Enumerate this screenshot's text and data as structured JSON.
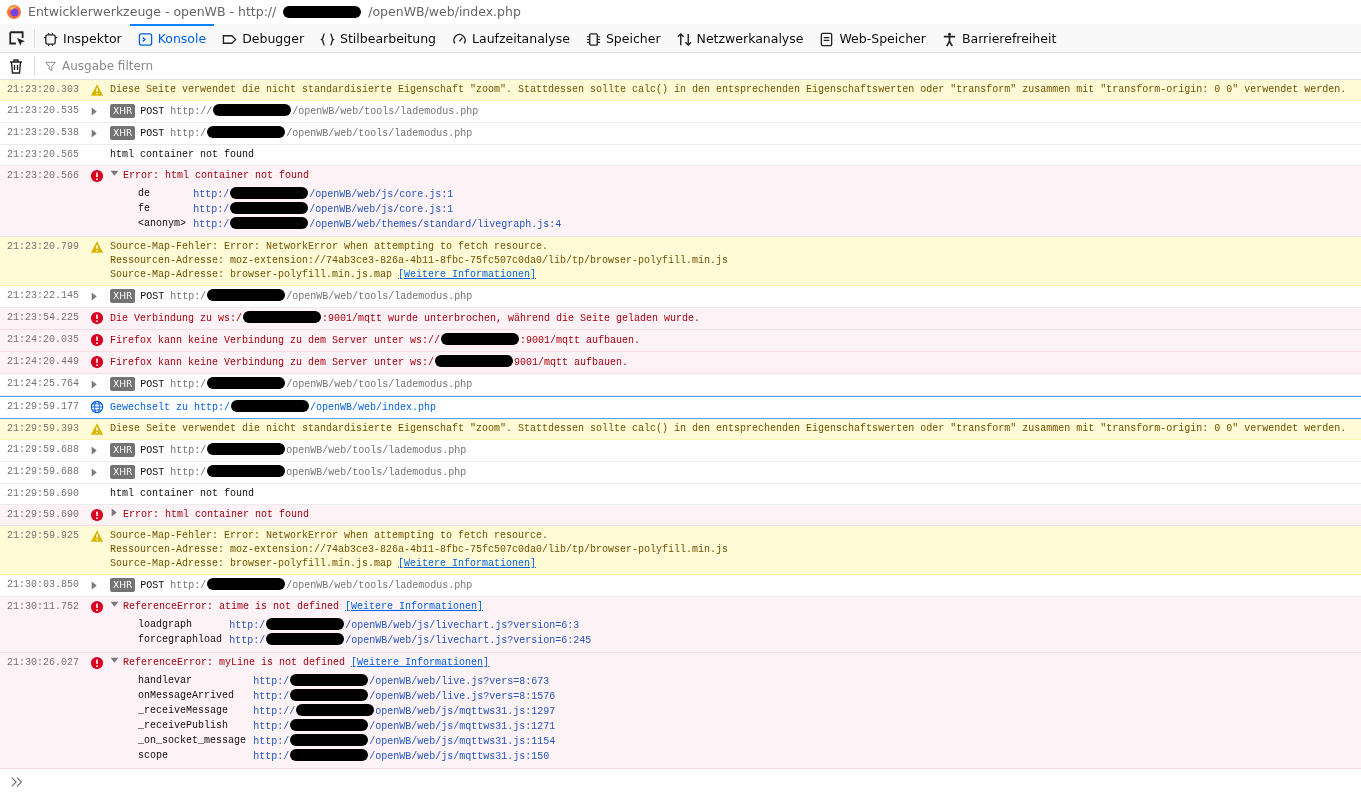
{
  "window": {
    "title": [
      {
        "kind": "text",
        "text": "Entwicklerwerkzeuge - openWB - http://"
      },
      {
        "kind": "redaction"
      },
      {
        "kind": "text",
        "text": "/openWB/web/index.php"
      }
    ]
  },
  "tabs": [
    {
      "label": "Inspektor",
      "selected": false
    },
    {
      "label": "Konsole",
      "selected": true
    },
    {
      "label": "Debugger",
      "selected": false
    },
    {
      "label": "Stilbearbeitung",
      "selected": false
    },
    {
      "label": "Laufzeitanalyse",
      "selected": false
    },
    {
      "label": "Speicher",
      "selected": false
    },
    {
      "label": "Netzwerkanalyse",
      "selected": false
    },
    {
      "label": "Web-Speicher",
      "selected": false
    },
    {
      "label": "Barrierefreiheit",
      "selected": false
    }
  ],
  "filter": {
    "placeholder": "Ausgabe filtern"
  },
  "messages": [
    {
      "time": "21:23:20.303",
      "kind": "warning",
      "lines": [
        [
          {
            "kind": "text",
            "text": "Diese Seite verwendet die nicht standardisierte Eigenschaft \"zoom\". Stattdessen sollte calc() in den entsprechenden Eigenschaftswerten oder \"transform\" zusammen mit \"transform-origin: 0 0\" verwendet werden."
          }
        ]
      ]
    },
    {
      "time": "21:23:20.535",
      "kind": "network",
      "expanded": false,
      "badge": "XHR",
      "method": "POST",
      "lines": [
        [
          {
            "kind": "url",
            "text": "http://"
          },
          {
            "kind": "redaction"
          },
          {
            "kind": "url",
            "text": "/openWB/web/tools/lademodus.php"
          }
        ]
      ]
    },
    {
      "time": "21:23:20.538",
      "kind": "network",
      "expanded": false,
      "badge": "XHR",
      "method": "POST",
      "lines": [
        [
          {
            "kind": "url",
            "text": "http:/"
          },
          {
            "kind": "redaction"
          },
          {
            "kind": "url",
            "text": "/openWB/web/tools/lademodus.php"
          }
        ]
      ]
    },
    {
      "time": "21:23:20.565",
      "kind": "log",
      "lines": [
        [
          {
            "kind": "text",
            "text": "html container not found"
          }
        ]
      ]
    },
    {
      "time": "21:23:20.566",
      "kind": "error",
      "expanded": true,
      "lines": [
        [
          {
            "kind": "text",
            "text": "Error: html container not found"
          }
        ]
      ],
      "stack": [
        {
          "fn": "de",
          "url": [
            {
              "kind": "url",
              "text": "http:/"
            },
            {
              "kind": "redaction"
            },
            {
              "kind": "url",
              "text": "/openWB/web/js/core.js:1"
            }
          ]
        },
        {
          "fn": "fe",
          "url": [
            {
              "kind": "url",
              "text": "http:/"
            },
            {
              "kind": "redaction"
            },
            {
              "kind": "url",
              "text": "/openWB/web/js/core.js:1"
            }
          ]
        },
        {
          "fn": "<anonym>",
          "url": [
            {
              "kind": "url",
              "text": "http:/"
            },
            {
              "kind": "redaction"
            },
            {
              "kind": "url",
              "text": "/openWB/web/themes/standard/livegraph.js:4"
            }
          ]
        }
      ]
    },
    {
      "time": "21:23:20.799",
      "kind": "warning",
      "lines": [
        [
          {
            "kind": "text",
            "text": "Source-Map-Fehler: Error: NetworkError when attempting to fetch resource."
          }
        ],
        [
          {
            "kind": "text",
            "text": "Ressourcen-Adresse: moz-extension://74ab3ce3-826a-4b11-8fbc-75fc507c0da0/lib/tp/browser-polyfill.min.js"
          }
        ],
        [
          {
            "kind": "text",
            "text": "Source-Map-Adresse: browser-polyfill.min.js.map"
          },
          {
            "kind": "link",
            "text": "[Weitere Informationen]"
          }
        ]
      ]
    },
    {
      "time": "21:23:22.145",
      "kind": "network",
      "expanded": false,
      "badge": "XHR",
      "method": "POST",
      "lines": [
        [
          {
            "kind": "url",
            "text": "http:/"
          },
          {
            "kind": "redaction"
          },
          {
            "kind": "url",
            "text": "/openWB/web/tools/lademodus.php"
          }
        ]
      ]
    },
    {
      "time": "21:23:54.225",
      "kind": "error",
      "lines": [
        [
          {
            "kind": "text",
            "text": "Die Verbindung zu ws:/"
          },
          {
            "kind": "redaction"
          },
          {
            "kind": "text",
            "text": ":9001/mqtt wurde unterbrochen, während die Seite geladen wurde."
          }
        ]
      ]
    },
    {
      "time": "21:24:20.035",
      "kind": "error",
      "lines": [
        [
          {
            "kind": "text",
            "text": "Firefox kann keine Verbindung zu dem Server unter ws://"
          },
          {
            "kind": "redaction"
          },
          {
            "kind": "text",
            "text": ":9001/mqtt aufbauen."
          }
        ]
      ]
    },
    {
      "time": "21:24:20.449",
      "kind": "error",
      "lines": [
        [
          {
            "kind": "text",
            "text": "Firefox kann keine Verbindung zu dem Server unter ws:/"
          },
          {
            "kind": "redaction"
          },
          {
            "kind": "text",
            "text": "9001/mqtt aufbauen."
          }
        ]
      ]
    },
    {
      "time": "21:24:25.764",
      "kind": "network",
      "expanded": false,
      "badge": "XHR",
      "method": "POST",
      "lines": [
        [
          {
            "kind": "url",
            "text": "http:/"
          },
          {
            "kind": "redaction"
          },
          {
            "kind": "url",
            "text": "/openWB/web/tools/lademodus.php"
          }
        ]
      ]
    },
    {
      "time": "21:29:59.177",
      "kind": "navigation",
      "lines": [
        [
          {
            "kind": "text",
            "text": "Gewechselt zu http:/"
          },
          {
            "kind": "redaction"
          },
          {
            "kind": "text",
            "text": "/openWB/web/index.php"
          }
        ]
      ]
    },
    {
      "time": "21:29:59.393",
      "kind": "warning",
      "lines": [
        [
          {
            "kind": "text",
            "text": "Diese Seite verwendet die nicht standardisierte Eigenschaft \"zoom\". Stattdessen sollte calc() in den entsprechenden Eigenschaftswerten oder \"transform\" zusammen mit \"transform-origin: 0 0\" verwendet werden."
          }
        ]
      ]
    },
    {
      "time": "21:29:59.688",
      "kind": "network",
      "expanded": false,
      "badge": "XHR",
      "method": "POST",
      "lines": [
        [
          {
            "kind": "url",
            "text": "http:/"
          },
          {
            "kind": "redaction"
          },
          {
            "kind": "url",
            "text": "openWB/web/tools/lademodus.php"
          }
        ]
      ]
    },
    {
      "time": "21:29:59.688",
      "kind": "network",
      "expanded": false,
      "badge": "XHR",
      "method": "POST",
      "lines": [
        [
          {
            "kind": "url",
            "text": "http:/"
          },
          {
            "kind": "redaction"
          },
          {
            "kind": "url",
            "text": "openWB/web/tools/lademodus.php"
          }
        ]
      ]
    },
    {
      "time": "21:29:59.690",
      "kind": "log",
      "lines": [
        [
          {
            "kind": "text",
            "text": "html container not found"
          }
        ]
      ]
    },
    {
      "time": "21:29:59.690",
      "kind": "error",
      "expanded": false,
      "lines": [
        [
          {
            "kind": "text",
            "text": "Error: html container not found"
          }
        ]
      ]
    },
    {
      "time": "21:29:59.925",
      "kind": "warning",
      "lines": [
        [
          {
            "kind": "text",
            "text": "Source-Map-Fehler: Error: NetworkError when attempting to fetch resource."
          }
        ],
        [
          {
            "kind": "text",
            "text": "Ressourcen-Adresse: moz-extension://74ab3ce3-826a-4b11-8fbc-75fc507c0da0/lib/tp/browser-polyfill.min.js"
          }
        ],
        [
          {
            "kind": "text",
            "text": "Source-Map-Adresse: browser-polyfill.min.js.map"
          },
          {
            "kind": "link",
            "text": "[Weitere Informationen]"
          }
        ]
      ]
    },
    {
      "time": "21:30:03.850",
      "kind": "network",
      "expanded": false,
      "badge": "XHR",
      "method": "POST",
      "lines": [
        [
          {
            "kind": "url",
            "text": "http:/"
          },
          {
            "kind": "redaction"
          },
          {
            "kind": "url",
            "text": "/openWB/web/tools/lademodus.php"
          }
        ]
      ]
    },
    {
      "time": "21:30:11.752",
      "kind": "error",
      "expanded": true,
      "lines": [
        [
          {
            "kind": "text",
            "text": "ReferenceError: atime is not defined"
          },
          {
            "kind": "link",
            "text": "[Weitere Informationen]"
          }
        ]
      ],
      "stack": [
        {
          "fn": "loadgraph",
          "url": [
            {
              "kind": "url",
              "text": "http:/"
            },
            {
              "kind": "redaction"
            },
            {
              "kind": "url",
              "text": "/openWB/web/js/livechart.js?version=6:3"
            }
          ]
        },
        {
          "fn": "forcegraphload",
          "url": [
            {
              "kind": "url",
              "text": "http:/"
            },
            {
              "kind": "redaction"
            },
            {
              "kind": "url",
              "text": "/openWB/web/js/livechart.js?version=6:245"
            }
          ]
        }
      ]
    },
    {
      "time": "21:30:26.027",
      "kind": "error",
      "expanded": true,
      "lines": [
        [
          {
            "kind": "text",
            "text": "ReferenceError: myLine is not defined"
          },
          {
            "kind": "link",
            "text": "[Weitere Informationen]"
          }
        ]
      ],
      "stack": [
        {
          "fn": "handlevar",
          "url": [
            {
              "kind": "url",
              "text": "http:/"
            },
            {
              "kind": "redaction"
            },
            {
              "kind": "url",
              "text": "/openWB/web/live.js?vers=8:673"
            }
          ]
        },
        {
          "fn": "onMessageArrived",
          "url": [
            {
              "kind": "url",
              "text": "http:/"
            },
            {
              "kind": "redaction"
            },
            {
              "kind": "url",
              "text": "/openWB/web/live.js?vers=8:1576"
            }
          ]
        },
        {
          "fn": "_receiveMessage",
          "url": [
            {
              "kind": "url",
              "text": "http://"
            },
            {
              "kind": "redaction"
            },
            {
              "kind": "url",
              "text": "openWB/web/js/mqttws31.js:1297"
            }
          ]
        },
        {
          "fn": "_receivePublish",
          "url": [
            {
              "kind": "url",
              "text": "http:/"
            },
            {
              "kind": "redaction"
            },
            {
              "kind": "url",
              "text": "/openWB/web/js/mqttws31.js:1271"
            }
          ]
        },
        {
          "fn": "_on_socket_message",
          "url": [
            {
              "kind": "url",
              "text": "http:/"
            },
            {
              "kind": "redaction"
            },
            {
              "kind": "url",
              "text": "/openWB/web/js/mqttws31.js:1154"
            }
          ]
        },
        {
          "fn": "scope",
          "url": [
            {
              "kind": "url",
              "text": "http:/"
            },
            {
              "kind": "redaction"
            },
            {
              "kind": "url",
              "text": "/openWB/web/js/mqttws31.js:150"
            }
          ]
        }
      ]
    }
  ]
}
